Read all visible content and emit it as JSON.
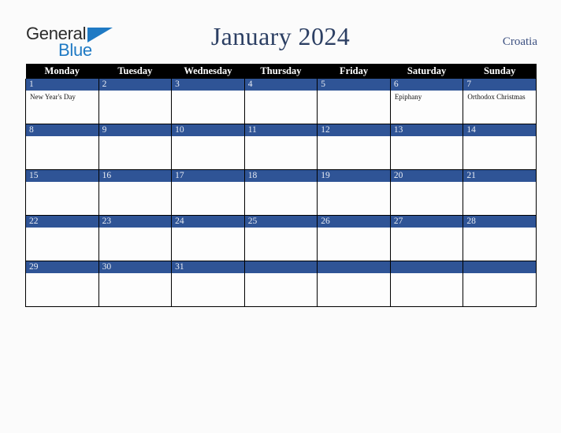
{
  "brand": {
    "line1": "General",
    "line2": "Blue",
    "triangle_color": "#1f7ac4",
    "text_color": "#2b2b2b"
  },
  "header": {
    "title": "January 2024",
    "country": "Croatia",
    "title_color": "#2c3f63",
    "country_color": "#3c5080"
  },
  "calendar": {
    "header_bg": "#000000",
    "daynum_bg": "#2f5496",
    "cell_bg": "#fdfdfd",
    "weekday_headers": [
      "Monday",
      "Tuesday",
      "Wednesday",
      "Thursday",
      "Friday",
      "Saturday",
      "Sunday"
    ],
    "weeks": [
      [
        {
          "day": "1",
          "event": "New Year's Day"
        },
        {
          "day": "2",
          "event": ""
        },
        {
          "day": "3",
          "event": ""
        },
        {
          "day": "4",
          "event": ""
        },
        {
          "day": "5",
          "event": ""
        },
        {
          "day": "6",
          "event": "Epiphany"
        },
        {
          "day": "7",
          "event": "Orthodox Christmas"
        }
      ],
      [
        {
          "day": "8",
          "event": ""
        },
        {
          "day": "9",
          "event": ""
        },
        {
          "day": "10",
          "event": ""
        },
        {
          "day": "11",
          "event": ""
        },
        {
          "day": "12",
          "event": ""
        },
        {
          "day": "13",
          "event": ""
        },
        {
          "day": "14",
          "event": ""
        }
      ],
      [
        {
          "day": "15",
          "event": ""
        },
        {
          "day": "16",
          "event": ""
        },
        {
          "day": "17",
          "event": ""
        },
        {
          "day": "18",
          "event": ""
        },
        {
          "day": "19",
          "event": ""
        },
        {
          "day": "20",
          "event": ""
        },
        {
          "day": "21",
          "event": ""
        }
      ],
      [
        {
          "day": "22",
          "event": ""
        },
        {
          "day": "23",
          "event": ""
        },
        {
          "day": "24",
          "event": ""
        },
        {
          "day": "25",
          "event": ""
        },
        {
          "day": "26",
          "event": ""
        },
        {
          "day": "27",
          "event": ""
        },
        {
          "day": "28",
          "event": ""
        }
      ],
      [
        {
          "day": "29",
          "event": ""
        },
        {
          "day": "30",
          "event": ""
        },
        {
          "day": "31",
          "event": ""
        },
        {
          "day": "",
          "event": ""
        },
        {
          "day": "",
          "event": ""
        },
        {
          "day": "",
          "event": ""
        },
        {
          "day": "",
          "event": ""
        }
      ]
    ]
  }
}
